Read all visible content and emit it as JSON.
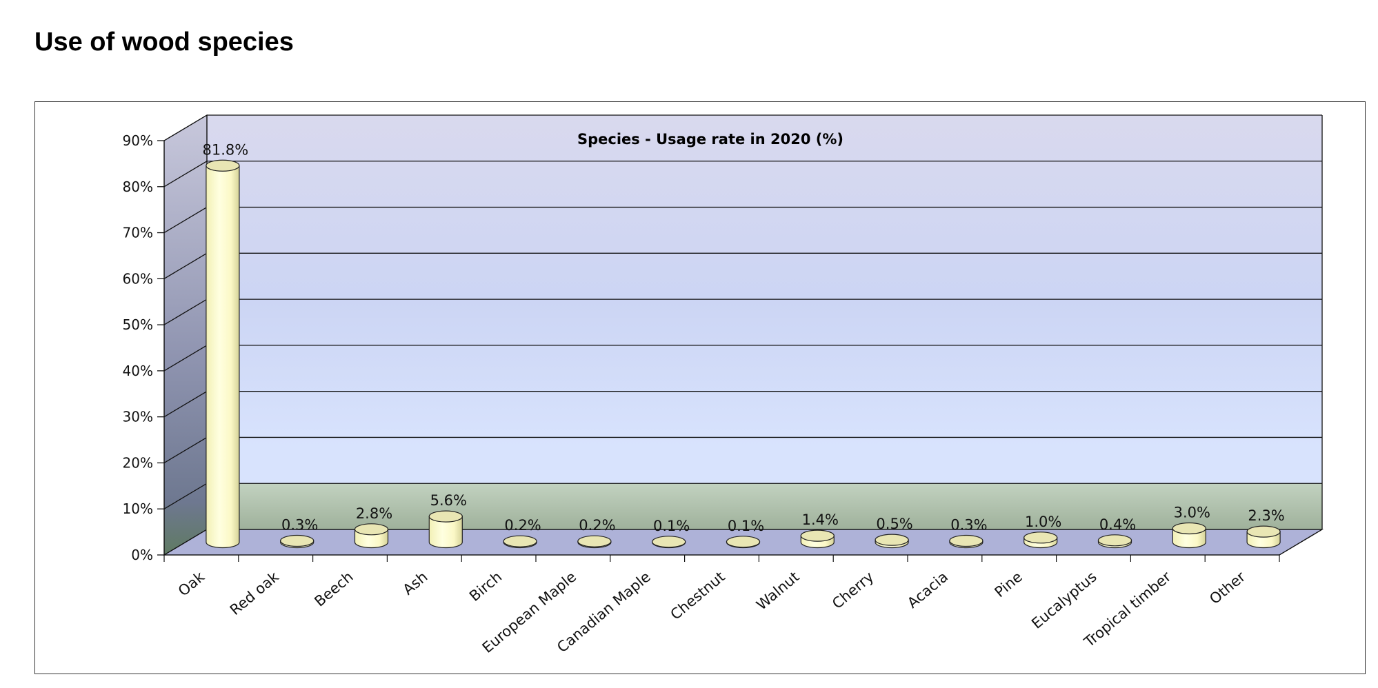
{
  "page": {
    "heading": "Use of wood species"
  },
  "colors": {
    "bar_fill": "#ffffcc",
    "bar_top": "#e9e6b4",
    "wall_top": "#d8d8ec",
    "wall_mid": "#d0dcf6",
    "wall_low": "#d7e2fb",
    "wall_band": "#a9bba9",
    "floor": "#aeb2d8",
    "grid": "#111111"
  },
  "chart_data": {
    "type": "bar",
    "title": "Species - Usage rate in 2020 (%)",
    "categories": [
      "Oak",
      "Red oak",
      "Beech",
      "Ash",
      "Birch",
      "European Maple",
      "Canadian Maple",
      "Chestnut",
      "Walnut",
      "Cherry",
      "Acacia",
      "Pine",
      "Eucalyptus",
      "Tropical timber",
      "Other"
    ],
    "values": [
      81.8,
      0.3,
      2.8,
      5.6,
      0.2,
      0.2,
      0.1,
      0.1,
      1.4,
      0.5,
      0.3,
      1.0,
      0.4,
      3.0,
      2.3
    ],
    "data_labels": [
      "81.8%",
      "0.3%",
      "2.8%",
      "5.6%",
      "0.2%",
      "0.2%",
      "0.1%",
      "0.1%",
      "1.4%",
      "0.5%",
      "0.3%",
      "1.0%",
      "0.4%",
      "3.0%",
      "2.3%"
    ],
    "ylim": [
      0,
      90
    ],
    "yticks": [
      0,
      10,
      20,
      30,
      40,
      50,
      60,
      70,
      80,
      90
    ],
    "ytick_labels": [
      "0%",
      "10%",
      "20%",
      "30%",
      "40%",
      "50%",
      "60%",
      "70%",
      "80%",
      "90%"
    ],
    "xlabel": "",
    "ylabel": "",
    "grid": true,
    "style": "3d-cylinder"
  }
}
